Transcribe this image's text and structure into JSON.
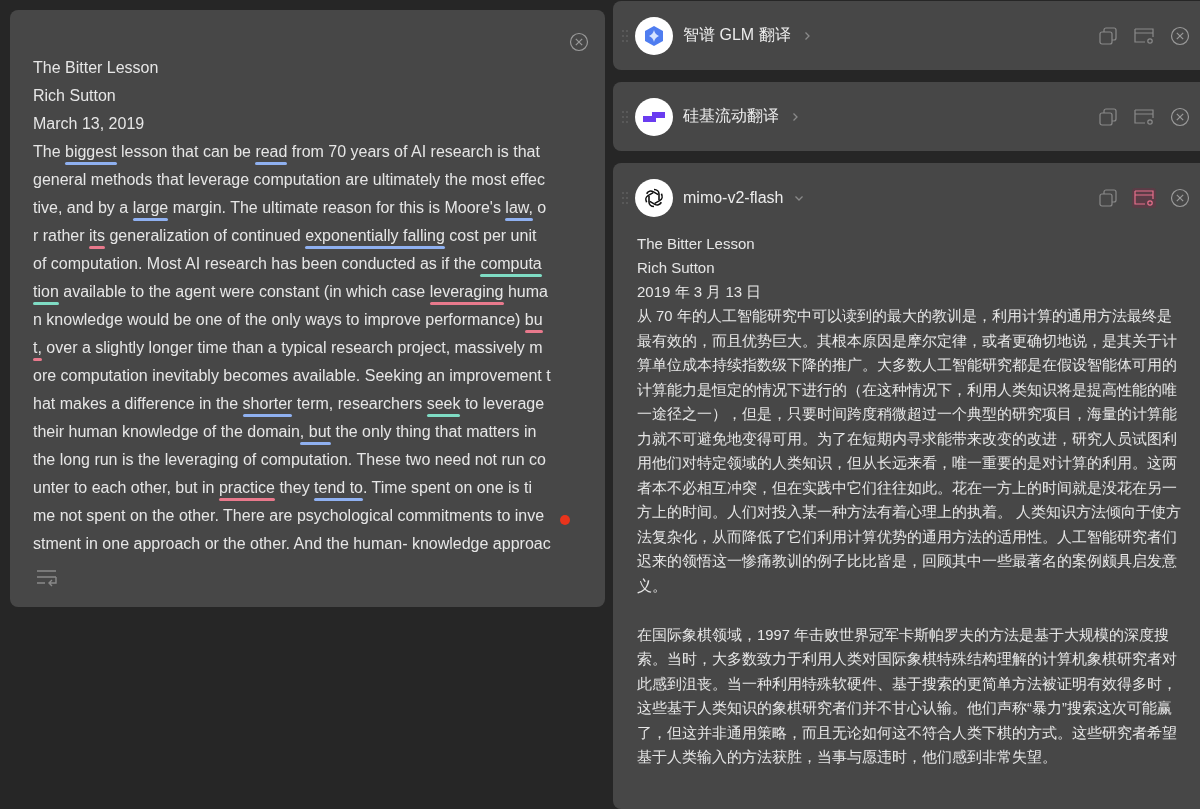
{
  "source_panel": {
    "lines": [
      [
        {
          "text": "The Bitter Lesson"
        }
      ],
      [
        {
          "text": "Rich Sutton"
        }
      ],
      [
        {
          "text": "March 13, 2019"
        }
      ],
      [
        {
          "text": "The "
        },
        {
          "text": "biggest",
          "color": "#8fb0f0"
        },
        {
          "text": " lesson that can be "
        },
        {
          "text": "read",
          "color": "#8fb0f0"
        },
        {
          "text": " from 70 years of AI research is that"
        }
      ],
      [
        {
          "text": "general methods that leverage computation are ultimately the most effec"
        }
      ],
      [
        {
          "text": "tive, and by a "
        },
        {
          "text": "large",
          "color": "#8fb0f0"
        },
        {
          "text": " margin. The ultimate reason for this is Moore's "
        },
        {
          "text": "law,",
          "color": "#8fb0f0"
        },
        {
          "text": " o"
        }
      ],
      [
        {
          "text": "r rather "
        },
        {
          "text": "its",
          "color": "#e8798c"
        },
        {
          "text": " generalization of continued "
        },
        {
          "text": "exponentially falling",
          "color": "#8fb0f0"
        },
        {
          "text": " cost per unit"
        }
      ],
      [
        {
          "text": "of computation. Most AI research has been conducted as if the "
        },
        {
          "text": "computa",
          "color": "#7fdcc4"
        }
      ],
      [
        {
          "text": "tion",
          "color": "#7fdcc4"
        },
        {
          "text": " available to the agent were constant (in which case "
        },
        {
          "text": "leveraging",
          "color": "#e8798c"
        },
        {
          "text": " huma"
        }
      ],
      [
        {
          "text": "n knowledge would be one of the only ways to improve performance) "
        },
        {
          "text": "bu",
          "color": "#e8798c"
        }
      ],
      [
        {
          "text": "t,",
          "color": "#e8798c"
        },
        {
          "text": " over a slightly longer time than a typical research project, massively m"
        }
      ],
      [
        {
          "text": "ore computation inevitably becomes available. Seeking an improvement t"
        }
      ],
      [
        {
          "text": "hat makes a difference in the "
        },
        {
          "text": "shorter",
          "color": "#8fb0f0"
        },
        {
          "text": " term, researchers "
        },
        {
          "text": "seek",
          "color": "#7fdcc4"
        },
        {
          "text": " to leverage"
        }
      ],
      [
        {
          "text": "their human knowledge of the domain"
        },
        {
          "text": ", but",
          "color": "#8fb0f0"
        },
        {
          "text": " the only thing that matters in"
        }
      ],
      [
        {
          "text": "the long run is the leveraging of computation. These two need not run co"
        }
      ],
      [
        {
          "text": "unter to each other, but in "
        },
        {
          "text": "practice",
          "color": "#e8798c"
        },
        {
          "text": " they "
        },
        {
          "text": "tend to",
          "color": "#8fb0f0"
        },
        {
          "text": ". Time spent on one is ti"
        }
      ],
      [
        {
          "text": "me not spent on the other. There are psychological commitments to inve"
        }
      ],
      [
        {
          "text": "stment in one approach or the other. And the human- knowledge approac"
        }
      ]
    ]
  },
  "translators": [
    {
      "name": "智谱 GLM 翻译",
      "kind": "diamond",
      "expanded": false,
      "pinned": false
    },
    {
      "name": "硅基流动翻译",
      "kind": "bars",
      "expanded": false,
      "pinned": false
    },
    {
      "name": "mimo-v2-flash",
      "kind": "knot",
      "expanded": true,
      "pinned": true,
      "heading_lines": [
        "The Bitter Lesson",
        "Rich Sutton",
        "2019 年 3 月 13 日"
      ],
      "paragraphs": [
        "从 70 年的人工智能研究中可以读到的最大的教训是，利用计算的通用方法最终是最有效的，而且优势巨大。其根本原因是摩尔定律，或者更确切地说，是其关于计算单位成本持续指数级下降的推广。大多数人工智能研究都是在假设智能体可用的计算能力是恒定的情况下进行的（在这种情况下，利用人类知识将是提高性能的唯一途径之一），但是，只要时间跨度稍微超过一个典型的研究项目，海量的计算能力就不可避免地变得可用。为了在短期内寻求能带来改变的改进，研究人员试图利用他们对特定领域的人类知识，但从长远来看，唯一重要的是对计算的利用。这两者本不必相互冲突，但在实践中它们往往如此。花在一方上的时间就是没花在另一方上的时间。人们对投入某一种方法有着心理上的执着。 人类知识方法倾向于使方法复杂化，从而降低了它们利用计算优势的通用方法的适用性。人工智能研究者们迟来的领悟这一惨痛教训的例子比比皆是，回顾其中一些最著名的案例颇具启发意义。",
        "在国际象棋领域，1997 年击败世界冠军卡斯帕罗夫的方法是基于大规模的深度搜索。当时，大多数致力于利用人类对国际象棋特殊结构理解的计算机象棋研究者对此感到沮丧。当一种利用特殊软硬件、基于搜索的更简单方法被证明有效得多时，这些基于人类知识的象棋研究者们并不甘心认输。他们声称“暴力”搜索这次可能赢了，但这并非通用策略，而且无论如何这不符合人类下棋的方式。这些研究者希望基于人类输入的方法获胜，当事与愿违时，他们感到非常失望。"
      ]
    }
  ]
}
